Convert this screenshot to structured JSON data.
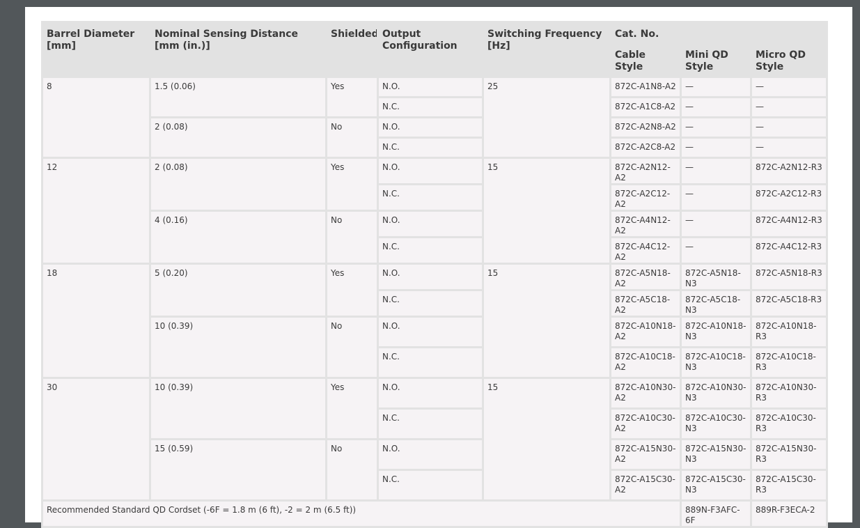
{
  "headers": {
    "barrel": "Barrel Diameter [mm]",
    "distance": "Nominal Sensing Distance [mm (in.)]",
    "shielded": "Shielded",
    "output": "Output Configuration",
    "frequency": "Switching Frequency [Hz]",
    "catno": "Cat. No.",
    "cable": "Cable Style",
    "mini": "Mini QD Style",
    "micro": "Micro QD Style"
  },
  "groups": [
    {
      "barrel": "8",
      "frequency": "25",
      "sub": [
        {
          "distance": "1.5 (0.06)",
          "shielded": "Yes",
          "rows": [
            {
              "output": "N.O.",
              "cable": "872C-A1N8-A2",
              "mini": "—",
              "micro": "—"
            },
            {
              "output": "N.C.",
              "cable": "872C-A1C8-A2",
              "mini": "—",
              "micro": "—"
            }
          ]
        },
        {
          "distance": "2 (0.08)",
          "shielded": "No",
          "rows": [
            {
              "output": "N.O.",
              "cable": "872C-A2N8-A2",
              "mini": "—",
              "micro": "—"
            },
            {
              "output": "N.C.",
              "cable": "872C-A2C8-A2",
              "mini": "—",
              "micro": "—"
            }
          ]
        }
      ]
    },
    {
      "barrel": "12",
      "frequency": "15",
      "sub": [
        {
          "distance": "2 (0.08)",
          "shielded": "Yes",
          "rows": [
            {
              "output": "N.O.",
              "cable": "872C-A2N12-A2",
              "mini": "—",
              "micro": "872C-A2N12-R3"
            },
            {
              "output": "N.C.",
              "cable": "872C-A2C12-A2",
              "mini": "—",
              "micro": "872C-A2C12-R3"
            }
          ]
        },
        {
          "distance": "4 (0.16)",
          "shielded": "No",
          "rows": [
            {
              "output": "N.O.",
              "cable": "872C-A4N12-A2",
              "mini": "—",
              "micro": "872C-A4N12-R3"
            },
            {
              "output": "N.C.",
              "cable": "872C-A4C12-A2",
              "mini": "—",
              "micro": "872C-A4C12-R3"
            }
          ]
        }
      ]
    },
    {
      "barrel": "18",
      "frequency": "15",
      "sub": [
        {
          "distance": "5 (0.20)",
          "shielded": "Yes",
          "rows": [
            {
              "output": "N.O.",
              "cable": "872C-A5N18-A2",
              "mini": "872C-A5N18-N3",
              "micro": "872C-A5N18-R3"
            },
            {
              "output": "N.C.",
              "cable": "872C-A5C18-A2",
              "mini": "872C-A5C18-N3",
              "micro": "872C-A5C18-R3"
            }
          ]
        },
        {
          "distance": "10 (0.39)",
          "shielded": "No",
          "rows": [
            {
              "output": "N.O.",
              "cable": "872C-A10N18-A2",
              "mini": "872C-A10N18-N3",
              "micro": "872C-A10N18-R3"
            },
            {
              "output": "N.C.",
              "cable": "872C-A10C18-A2",
              "mini": "872C-A10C18-N3",
              "micro": "872C-A10C18-R3"
            }
          ]
        }
      ]
    },
    {
      "barrel": "30",
      "frequency": "15",
      "sub": [
        {
          "distance": "10 (0.39)",
          "shielded": "Yes",
          "rows": [
            {
              "output": "N.O.",
              "cable": "872C-A10N30-A2",
              "mini": "872C-A10N30-N3",
              "micro": "872C-A10N30-R3"
            },
            {
              "output": "N.C.",
              "cable": "872C-A10C30-A2",
              "mini": "872C-A10C30-N3",
              "micro": "872C-A10C30-R3"
            }
          ]
        },
        {
          "distance": "15 (0.59)",
          "shielded": "No",
          "rows": [
            {
              "output": "N.O.",
              "cable": "872C-A15N30-A2",
              "mini": "872C-A15N30-N3",
              "micro": "872C-A15N30-R3"
            },
            {
              "output": "N.C.",
              "cable": "872C-A15C30-A2",
              "mini": "872C-A15C30-N3",
              "micro": "872C-A15C30-R3"
            }
          ]
        }
      ]
    }
  ],
  "footer": {
    "label": "Recommended Standard QD Cordset (-6F = 1.8 m (6 ft), -2 = 2 m (6.5 ft))",
    "mini": "889N-F3AFC-6F",
    "micro": "889R-F3ECA-2"
  }
}
